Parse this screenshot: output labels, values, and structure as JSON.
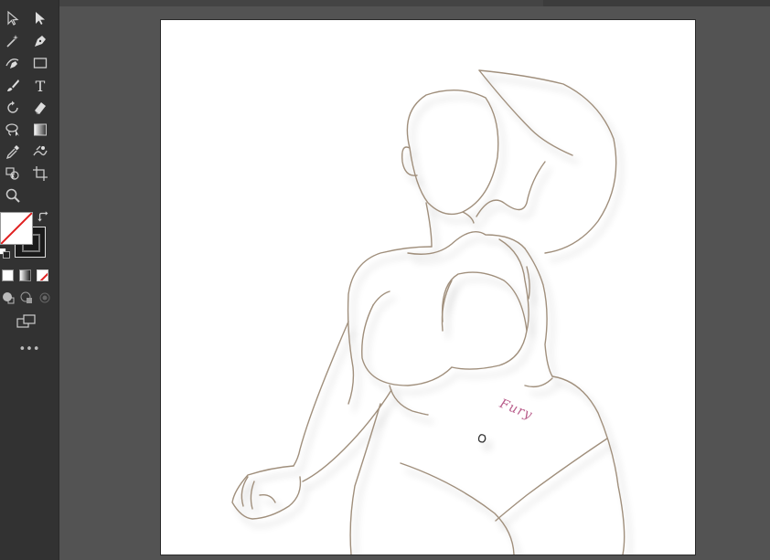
{
  "app": {
    "accent": "#535353",
    "toolbar_bg": "#323232"
  },
  "tools": [
    {
      "name": "selection-tool",
      "icon": "arrow-outline"
    },
    {
      "name": "direct-selection-tool",
      "icon": "arrow-filled"
    },
    {
      "name": "magic-wand-tool",
      "icon": "wand"
    },
    {
      "name": "pen-tool",
      "icon": "pen-nib"
    },
    {
      "name": "curvature-tool",
      "icon": "curvature-pen"
    },
    {
      "name": "rectangle-tool",
      "icon": "rectangle"
    },
    {
      "name": "paintbrush-tool",
      "icon": "brush"
    },
    {
      "name": "type-tool",
      "icon": "letter-t",
      "label": "T"
    },
    {
      "name": "rotate-tool",
      "icon": "rotate"
    },
    {
      "name": "eraser-tool",
      "icon": "eraser"
    },
    {
      "name": "lasso-tool",
      "icon": "lasso"
    },
    {
      "name": "gradient-tool",
      "icon": "gradient"
    },
    {
      "name": "eyedropper-tool",
      "icon": "eyedropper"
    },
    {
      "name": "puppet-warp-tool",
      "icon": "puppet"
    },
    {
      "name": "shape-builder-tool",
      "icon": "shape-builder"
    },
    {
      "name": "artboard-tool",
      "icon": "artboard"
    },
    {
      "name": "zoom-tool",
      "icon": "magnifier"
    }
  ],
  "colors": {
    "fill": "none",
    "stroke": "#1a1a1a",
    "none_slash": "#e02020",
    "swap_icon": "swap-arrow-icon",
    "default_icon": "default-colors-icon"
  },
  "color_modes": [
    "color",
    "gradient",
    "none"
  ],
  "draw_modes": [
    "draw-normal",
    "draw-behind",
    "draw-inside"
  ],
  "screen_mode_icon": "screen-mode-icon",
  "more_label": "•••",
  "artwork": {
    "stroke_color": "#a08f7c",
    "tattoo_text": "Fury",
    "tattoo_color": "#b85c8a"
  }
}
